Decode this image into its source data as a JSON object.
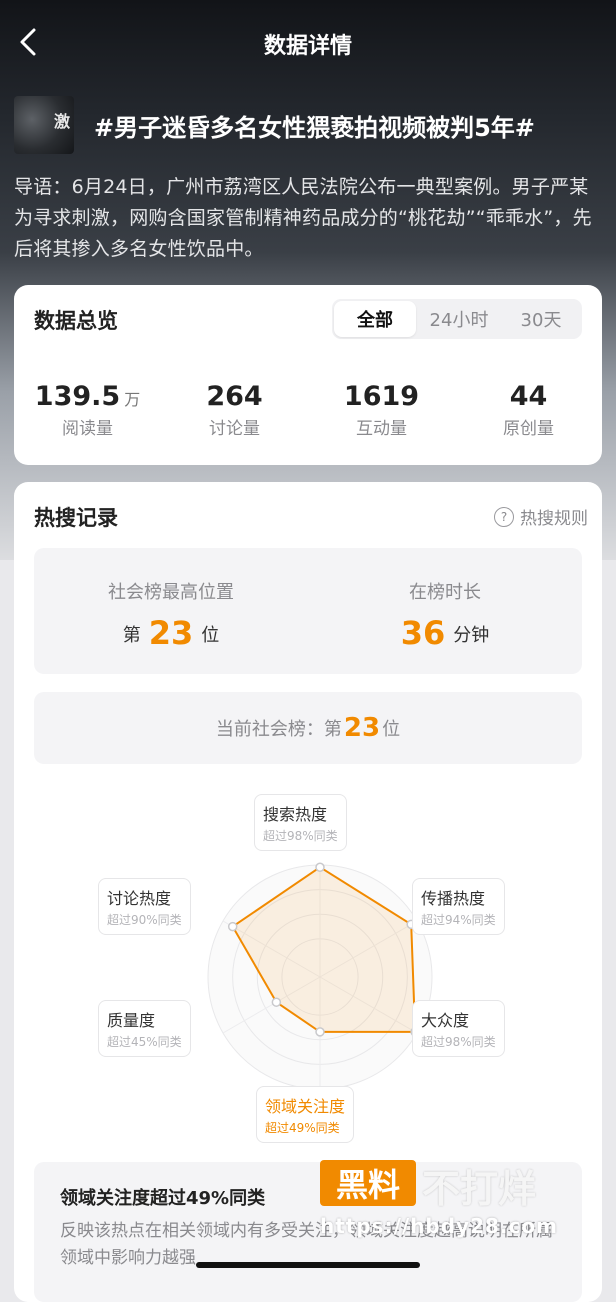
{
  "nav": {
    "title": "数据详情"
  },
  "topic": {
    "title": "#男子迷昏多名女性猥亵拍视频被判5年#",
    "thumb_text": "激",
    "intro": "导语：6月24日，广州市荔湾区人民法院公布一典型案例。男子严某为寻求刺激，网购含国家管制精神药品成分的“桃花劫”“乖乖水”，先后将其掺入多名女性饮品中。"
  },
  "overview": {
    "title": "数据总览",
    "tabs": [
      "全部",
      "24小时",
      "30天"
    ],
    "active_tab": "全部",
    "stats": [
      {
        "value": "139.5",
        "unit": "万",
        "label": "阅读量"
      },
      {
        "value": "264",
        "unit": "",
        "label": "讨论量"
      },
      {
        "value": "1619",
        "unit": "",
        "label": "互动量"
      },
      {
        "value": "44",
        "unit": "",
        "label": "原创量"
      }
    ]
  },
  "hot": {
    "title": "热搜记录",
    "rules": "热搜规则",
    "rules_icon": "?",
    "peak": {
      "label": "社会榜最高位置",
      "prefix": "第",
      "value": "23",
      "suffix": "位"
    },
    "duration": {
      "label": "在榜时长",
      "value": "36",
      "suffix": "分钟"
    },
    "current": {
      "prefix": "当前社会榜：第",
      "value": "23",
      "suffix": "位"
    }
  },
  "radar": {
    "dims": [
      {
        "name": "搜索热度",
        "sub": "超过98%同类",
        "score": 0.98
      },
      {
        "name": "传播热度",
        "sub": "超过94%同类",
        "score": 0.94
      },
      {
        "name": "大众度",
        "sub": "超过98%同类",
        "score": 0.98
      },
      {
        "name": "领域关注度",
        "sub": "超过49%同类",
        "score": 0.49
      },
      {
        "name": "质量度",
        "sub": "超过45%同类",
        "score": 0.45
      },
      {
        "name": "讨论热度",
        "sub": "超过90%同类",
        "score": 0.9
      }
    ],
    "highlight": "领域关注度",
    "color": "#f18a00"
  },
  "insight": {
    "title": "领域关注度超过49%同类",
    "text": "反映该热点在相关领域内有多受关注，领域关注度越高说明在所属领域中影响力越强"
  },
  "watermark": {
    "box": "黑料",
    "text": "不打烊",
    "url": "https://hbdy28.com"
  }
}
